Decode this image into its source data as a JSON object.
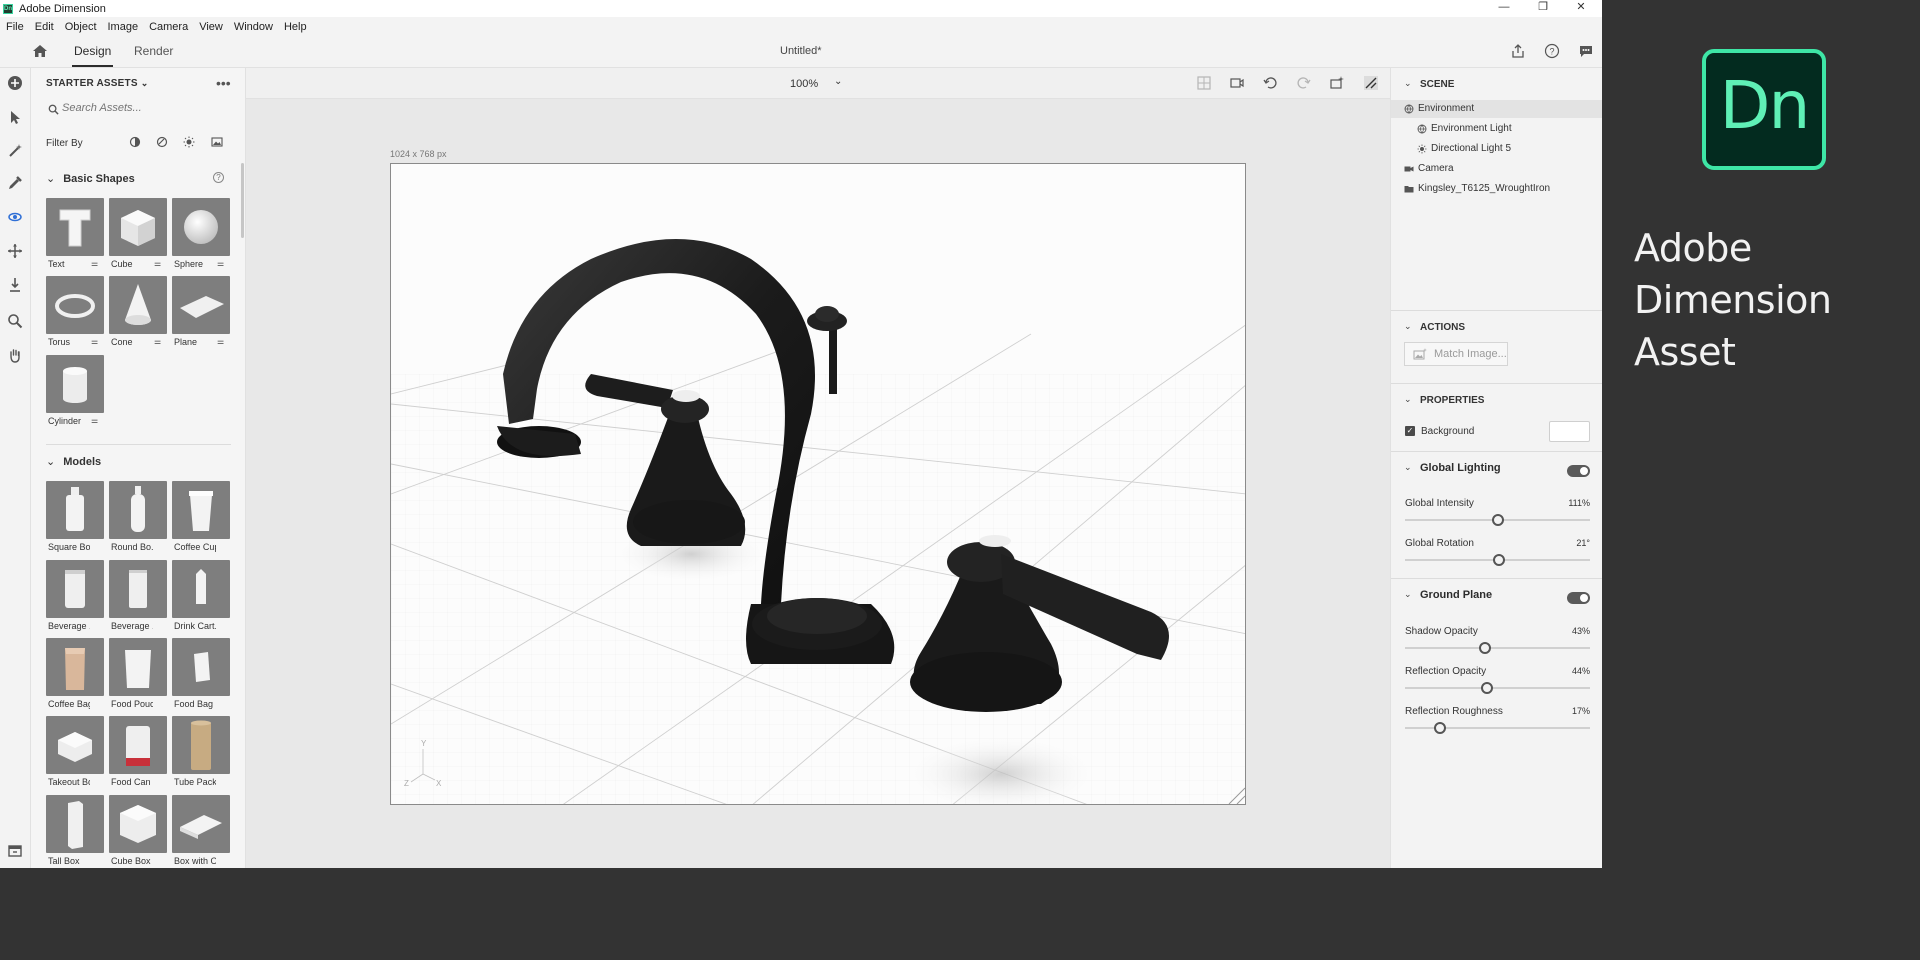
{
  "window": {
    "title": "Adobe Dimension",
    "minimize": "—",
    "restore": "❐",
    "close": "✕"
  },
  "menu": [
    "File",
    "Edit",
    "Object",
    "Image",
    "Camera",
    "View",
    "Window",
    "Help"
  ],
  "topbar": {
    "tabs": [
      "Design",
      "Render"
    ],
    "active_tab": "Design",
    "doc_title": "Untitled*"
  },
  "assets": {
    "panel_title": "STARTER ASSETS",
    "search_placeholder": "Search Assets...",
    "filter_label": "Filter By",
    "basic_shapes": {
      "title": "Basic Shapes",
      "items": [
        "Text",
        "Cube",
        "Sphere",
        "Torus",
        "Cone",
        "Plane",
        "Cylinder"
      ]
    },
    "models": {
      "title": "Models",
      "items": [
        "Square Bo...",
        "Round Bo...",
        "Coffee Cup",
        "Beverage ...",
        "Beverage ...",
        "Drink Cart...",
        "Coffee Bag",
        "Food Pouch",
        "Food Bag",
        "Takeout Box",
        "Food Can",
        "Tube Pack...",
        "Tall Box",
        "Cube Box",
        "Box with O..."
      ]
    }
  },
  "canvas": {
    "zoom": "100%",
    "dimensions": "1024 x 768 px",
    "axes": {
      "y": "Y",
      "z": "Z",
      "x": "X"
    }
  },
  "scene": {
    "title": "SCENE",
    "tree": [
      "Environment",
      "Environment Light",
      "Directional Light 5",
      "Camera",
      "Kingsley_T6125_WroughtIron"
    ],
    "selected": "Environment"
  },
  "actions": {
    "title": "ACTIONS",
    "match_image": "Match Image..."
  },
  "properties": {
    "title": "PROPERTIES",
    "background_label": "Background",
    "global_lighting": {
      "title": "Global Lighting",
      "intensity": {
        "label": "Global Intensity",
        "value": "111%",
        "level": 0.5
      },
      "rotation": {
        "label": "Global Rotation",
        "value": "21°",
        "level": 0.51
      }
    },
    "ground_plane": {
      "title": "Ground Plane",
      "shadow_opacity": {
        "label": "Shadow Opacity",
        "value": "43%",
        "level": 0.43
      },
      "reflection_opacity": {
        "label": "Reflection Opacity",
        "value": "44%",
        "level": 0.44
      },
      "reflection_roughness": {
        "label": "Reflection Roughness",
        "value": "17%",
        "level": 0.17
      }
    }
  },
  "desktop": {
    "logo": "Dn",
    "caption_line1": "Adobe Dimension",
    "caption_line2": "Asset"
  },
  "colors": {
    "accent": "#3ee6a6",
    "desktop_bg": "#333333",
    "logo_bg": "#032b1f",
    "toggle_on": "#5a5a5a"
  }
}
